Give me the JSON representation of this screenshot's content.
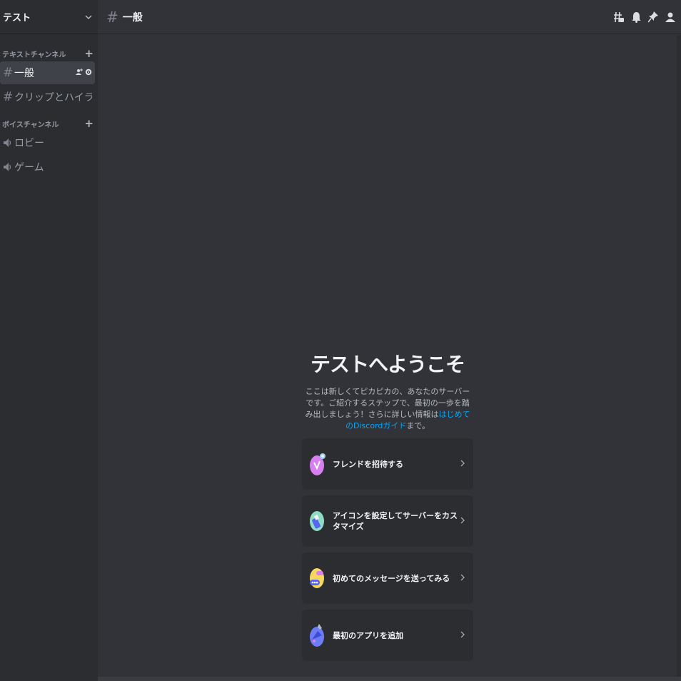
{
  "server": {
    "name": "テスト",
    "menu_icon": "chevron-down-icon"
  },
  "categories": {
    "text": {
      "label": "テキストチャンネル"
    },
    "voice": {
      "label": "ボイスチャンネル"
    }
  },
  "text_channels": [
    {
      "name": "一般",
      "active": true
    },
    {
      "name": "クリップとハイライト",
      "active": false
    }
  ],
  "voice_channels": [
    {
      "name": "ロビー"
    },
    {
      "name": "ゲーム"
    }
  ],
  "topbar": {
    "channel": "一般",
    "icons": [
      "threads-icon",
      "bell-icon",
      "pin-icon",
      "members-icon"
    ]
  },
  "welcome": {
    "title": "テストへようこそ",
    "desc_before": "ここは新しくてピカピカの、あなたのサーバーです。ご紹介するステップで、最初の一歩を踏み出しましょう！さらに詳しい情報は",
    "link": "はじめてのDiscordガイド",
    "desc_after": "まで。"
  },
  "cards": [
    {
      "label": "フレンドを招待する",
      "icon": "invite-friends-icon",
      "color": "#e07ff0"
    },
    {
      "label": "アイコンを設定してサーバーをカスタマイズ",
      "icon": "customize-icon",
      "color": "#7fd3b8"
    },
    {
      "label": "初めてのメッセージを送ってみる",
      "icon": "message-icon",
      "color": "#f6d860"
    },
    {
      "label": "最初のアプリを追加",
      "icon": "app-icon",
      "color": "#6b7cf6"
    }
  ],
  "colors": {
    "accent_link": "#00a8fc",
    "sidebar_bg": "#2b2d31",
    "main_bg": "#313338",
    "active_channel_bg": "#404249"
  }
}
